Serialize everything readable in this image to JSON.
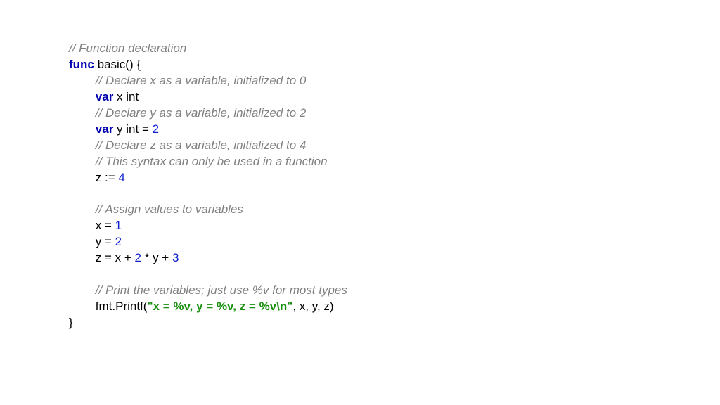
{
  "code": {
    "c1": "// Function declaration",
    "kw_func": "func",
    "fn_sig": " basic() {",
    "c2": "// Declare x as a variable, initialized to 0",
    "kw_var1": "var",
    "var_x": " x int",
    "c3": "// Declare y as a variable, initialized to 2",
    "kw_var2": "var",
    "var_y_a": " y int = ",
    "num_2a": "2",
    "c4": "// Declare z as a variable, initialized to 4",
    "c5": "// This syntax can only be used in a function",
    "z_decl_a": "z := ",
    "num_4": "4",
    "c6": "// Assign values to variables",
    "x_assign": "x = ",
    "num_1": "1",
    "y_assign": "y = ",
    "num_2b": "2",
    "z_assign_a": "z = x + ",
    "num_2c": "2",
    "z_assign_b": " * y + ",
    "num_3": "3",
    "c7": "// Print the variables; just use %v for most types",
    "printf_a": "fmt.Printf(",
    "str": "\"x = %v, y = %v, z = %v\\n\"",
    "printf_b": ", x, y, z)",
    "close": "}"
  }
}
